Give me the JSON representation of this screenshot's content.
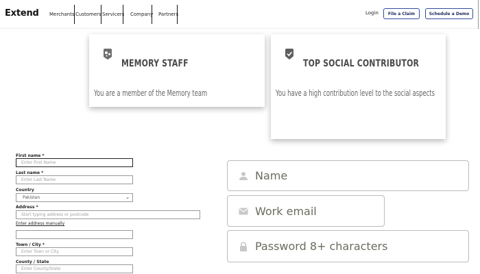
{
  "header": {
    "logo": "Extend",
    "nav": [
      "Merchants",
      "Customers",
      "Servicers",
      "Company",
      "Partners"
    ],
    "login": "Login",
    "file_claim": "File a Claim",
    "schedule_demo": "Schedule a Demo"
  },
  "badges": [
    {
      "title": "MEMORY STAFF",
      "description": "You are a member of the Memory team",
      "icon": "memory-chip-icon"
    },
    {
      "title": "TOP SOCIAL CONTRIBUTOR",
      "description": "You have a high contribution level to the social aspects",
      "icon": "shield-check-icon"
    }
  ],
  "address_form": {
    "first_name_label": "First name *",
    "first_name_placeholder": "Enter First Name",
    "last_name_label": "Last name *",
    "last_name_placeholder": "Enter Last Name",
    "country_label": "Country",
    "country_value": "Pakistan",
    "address_label": "Address *",
    "address_placeholder": "Start typing address or postcode",
    "manual_link": "Enter address manually",
    "manual_value": "",
    "town_label": "Town / City *",
    "town_placeholder": "Enter Town or City",
    "county_label": "County / State",
    "county_placeholder": "Enter County/State"
  },
  "signup_form": {
    "name_placeholder": "Name",
    "email_placeholder": "Work email",
    "password_placeholder": "Password 8+ characters"
  },
  "colors": {
    "button_border": "#2f4d9c",
    "placeholder_text": "#6b6b5e",
    "field_icon": "#c8c8c8"
  }
}
